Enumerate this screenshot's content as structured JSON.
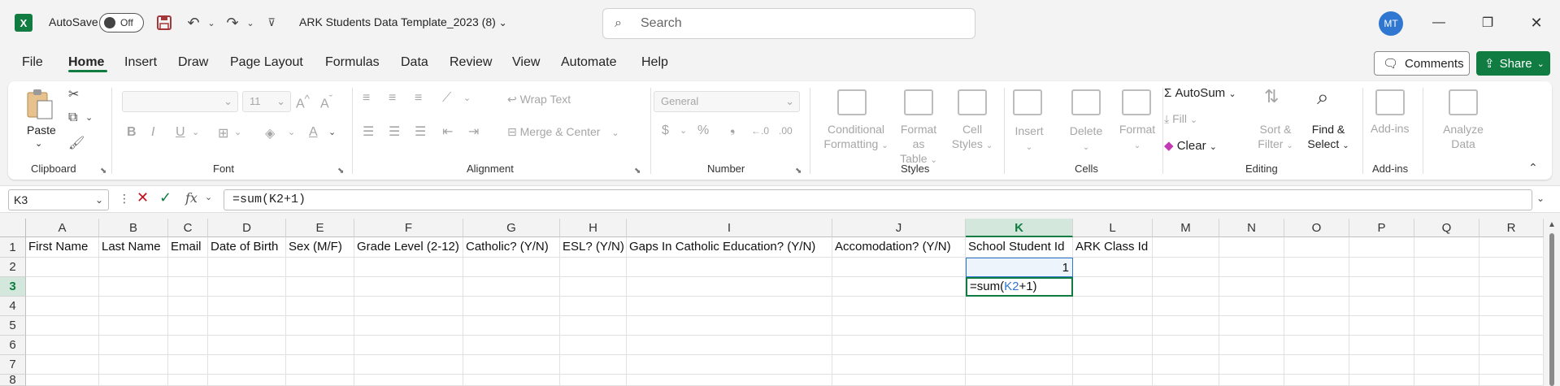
{
  "titlebar": {
    "autosave_label": "AutoSave",
    "toggle_text": "Off",
    "doc_title": "ARK Students Data Template_2023 (8)",
    "search_placeholder": "Search",
    "avatar": "MT",
    "icons": [
      "excel-logo",
      "save-icon",
      "undo-icon",
      "redo-icon",
      "customize-qat-icon",
      "search-icon",
      "minimize-icon",
      "restore-icon",
      "close-icon"
    ]
  },
  "menu": {
    "tabs": [
      "File",
      "Home",
      "Insert",
      "Draw",
      "Page Layout",
      "Formulas",
      "Data",
      "Review",
      "View",
      "Automate",
      "Help"
    ],
    "active": "Home",
    "comments": "Comments",
    "share": "Share"
  },
  "ribbon": {
    "clipboard": {
      "paste": "Paste",
      "label": "Clipboard"
    },
    "font": {
      "font_name": "",
      "font_size": "11",
      "label": "Font"
    },
    "alignment": {
      "wrap": "Wrap Text",
      "merge": "Merge & Center",
      "label": "Alignment"
    },
    "number": {
      "format": "General",
      "label": "Number"
    },
    "styles": {
      "conditional_1": "Conditional",
      "conditional_2": "Formatting",
      "format_table_1": "Format as",
      "format_table_2": "Table",
      "cell_styles_1": "Cell",
      "cell_styles_2": "Styles",
      "label": "Styles"
    },
    "cells": {
      "insert": "Insert",
      "delete": "Delete",
      "format": "Format",
      "label": "Cells"
    },
    "editing": {
      "autosum": "AutoSum",
      "fill": "Fill",
      "clear": "Clear",
      "sort_1": "Sort &",
      "sort_2": "Filter",
      "find_1": "Find &",
      "find_2": "Select",
      "label": "Editing"
    },
    "addins": {
      "addins": "Add-ins",
      "label": "Add-ins"
    },
    "analyze": {
      "line1": "Analyze",
      "line2": "Data"
    },
    "accent": "#107c41"
  },
  "formula_bar": {
    "name_box": "K3",
    "formula": "=sum(K2+1)"
  },
  "sheet": {
    "columns": [
      "A",
      "B",
      "C",
      "D",
      "E",
      "F",
      "G",
      "H",
      "I",
      "J",
      "K",
      "L",
      "M",
      "N",
      "O",
      "P",
      "Q",
      "R"
    ],
    "rows": [
      "1",
      "2",
      "3",
      "4",
      "5",
      "6",
      "7",
      "8"
    ],
    "headers": [
      "First Name",
      "Last Name",
      "Email",
      "Date of Birth",
      "Sex (M/F)",
      "Grade Level (2-12)",
      "Catholic? (Y/N)",
      "ESL? (Y/N)",
      "Gaps In Catholic Education? (Y/N)",
      "Accomodation? (Y/N)",
      "School Student Id",
      "ARK Class Id"
    ],
    "k2_value": "1",
    "k3_edit_prefix": "=sum(",
    "k3_edit_ref": "K2",
    "k3_edit_suffix": "+1)",
    "selected_column": "K",
    "selected_row": "3"
  }
}
